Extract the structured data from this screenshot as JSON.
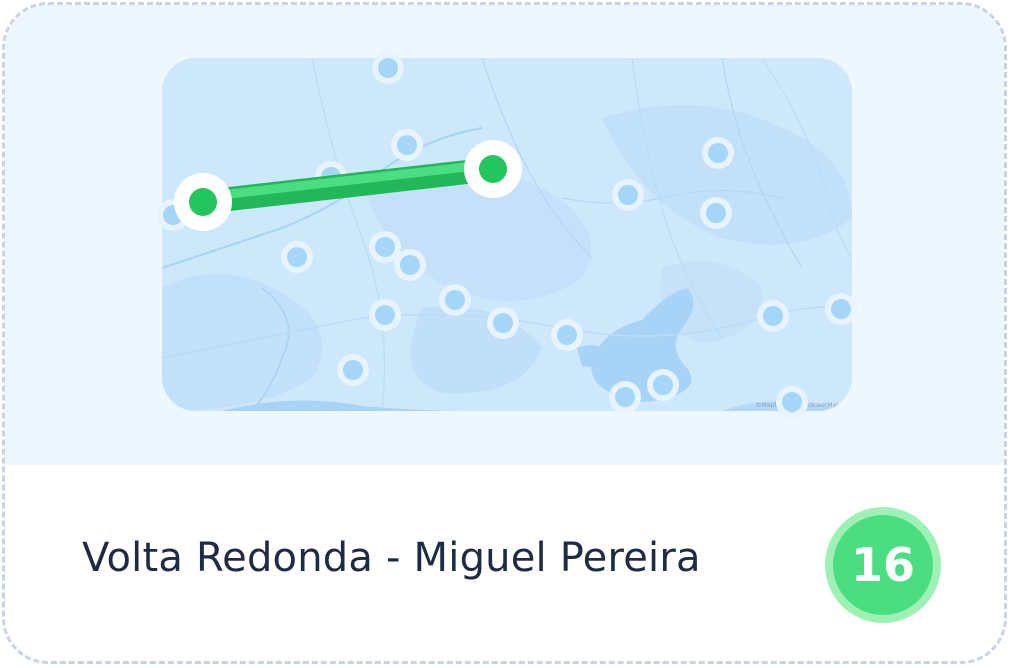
{
  "card": {
    "title": "Volta Redonda - Miguel Pereira",
    "count": "16"
  },
  "map": {
    "credit": "©Mapbox ©OpenStreetMap",
    "route_color": "#3ccf6e",
    "pin_color": "#a6d6f7",
    "endpoint_color": "#22c55e"
  }
}
